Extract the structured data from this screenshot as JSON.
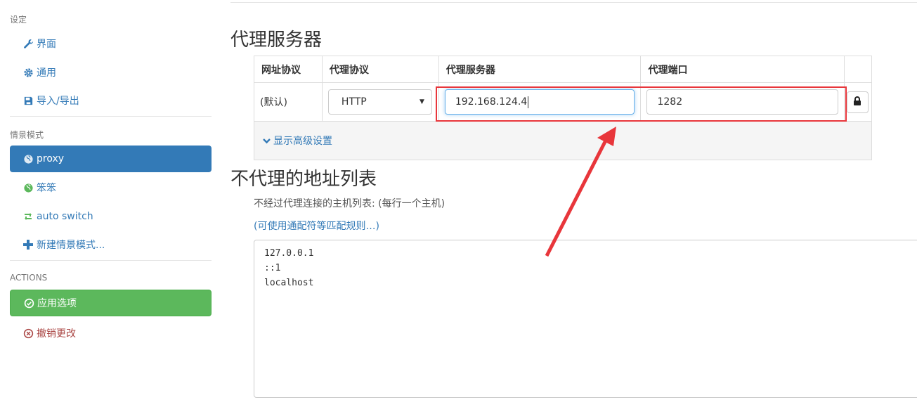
{
  "sidebar": {
    "settings_label": "设定",
    "settings_items": [
      {
        "label": "界面",
        "icon": "wrench-icon"
      },
      {
        "label": "通用",
        "icon": "gear-icon"
      },
      {
        "label": "导入/导出",
        "icon": "floppy-icon"
      }
    ],
    "profiles_label": "情景模式",
    "profiles": [
      {
        "label": "proxy",
        "icon": "globe-icon",
        "active": true
      },
      {
        "label": "笨笨",
        "icon": "globe-icon",
        "color": "#5cb85c"
      },
      {
        "label": "auto switch",
        "icon": "retweet-icon",
        "color": "#5cb85c"
      },
      {
        "label": "新建情景模式...",
        "icon": "plus-icon"
      }
    ],
    "actions_label": "ACTIONS",
    "apply_label": "应用选项",
    "discard_label": "撤销更改"
  },
  "main": {
    "proxy_title": "代理服务器",
    "table": {
      "headers": [
        "网址协议",
        "代理协议",
        "代理服务器",
        "代理端口"
      ],
      "row": {
        "scheme": "(默认)",
        "protocol": "HTTP",
        "server": "192.168.124.4",
        "port": "1282"
      },
      "advanced_label": "显示高级设置"
    },
    "bypass_title": "不代理的地址列表",
    "bypass_desc": "不经过代理连接的主机列表: (每行一个主机)",
    "wildcard_link": "(可使用通配符等匹配规则…)",
    "bypass_list": [
      "127.0.0.1",
      "::1",
      "localhost"
    ]
  },
  "colors": {
    "primary": "#337ab7",
    "success": "#5cb85c",
    "danger": "#a94442",
    "annotation": "#e8363b"
  }
}
